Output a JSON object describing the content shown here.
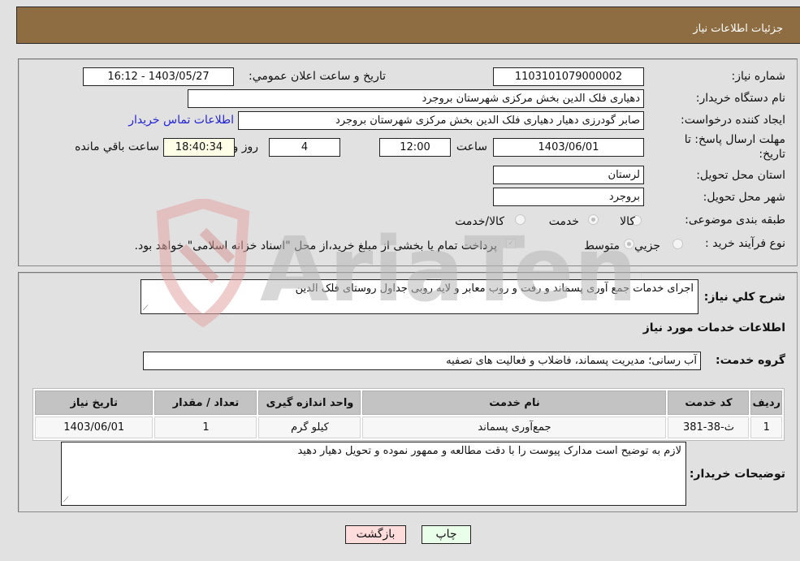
{
  "header": {
    "title": "جزئيات اطلاعات نياز"
  },
  "details": {
    "need_number_label": "شماره نیاز:",
    "need_number": "1103101079000002",
    "announce_label": "تاريخ و ساعت اعلان عمومي:",
    "announce_value": "1403/05/27 - 16:12",
    "buyer_org_label": "نام دستگاه خریدار:",
    "buyer_org": "دهیاری فلک الدین بخش مرکزی شهرستان بروجرد",
    "creator_label": "ایجاد کننده درخواست:",
    "creator": "صابر گودرزی دهیار دهیاری فلک الدین بخش مرکزی شهرستان بروجرد",
    "contact_link": "اطلاعات تماس خریدار",
    "deadline_label_line1": "مهلت ارسال پاسخ: تا",
    "deadline_label_line2": "تاریخ:",
    "deadline_date": "1403/06/01",
    "time_label": "ساعت",
    "deadline_time": "12:00",
    "days_value": "4",
    "days_label": "روز و",
    "remaining_time": "18:40:34",
    "remaining_label": "ساعت باقي مانده",
    "province_label": "استان محل تحویل:",
    "province": "لرستان",
    "city_label": "شهر محل تحویل:",
    "city": "بروجرد",
    "category_label": "طبقه بندی موضوعی:",
    "category_options": [
      {
        "label": "کالا",
        "checked": false
      },
      {
        "label": "خدمت",
        "checked": true
      },
      {
        "label": "کالا/خدمت",
        "checked": false
      }
    ],
    "process_label": "نوع فرآیند خرید :",
    "process_options": [
      {
        "label": "جزيي",
        "checked": false
      },
      {
        "label": "متوسط",
        "checked": true
      }
    ],
    "payment_note": "پرداخت تمام یا بخشی از مبلغ خرید،از محل \"اسناد خزانه اسلامی\" خواهد بود.",
    "payment_checked": true
  },
  "description": {
    "label": "شرح كلي نياز:",
    "value": "اجرای خدمات جمع آوری پسماند و رفت و روب معابر و لایه روبی جداول روستای فلک الدین"
  },
  "services": {
    "section_title": "اطلاعات خدمات مورد نياز",
    "group_label": "گروه خدمت:",
    "group_value": "آب رسانی؛ مدیریت پسماند، فاضلاب و فعالیت های تصفیه",
    "table": {
      "headers": [
        "ردیف",
        "کد خدمت",
        "نام خدمت",
        "واحد اندازه گیری",
        "تعداد / مقدار",
        "تاریخ نیاز"
      ],
      "rows": [
        [
          "1",
          "ث-38-381",
          "جمع‌آوری پسماند",
          "کیلو گرم",
          "1",
          "1403/06/01"
        ]
      ]
    }
  },
  "buyer_notes": {
    "label": "توضیحات خریدار:",
    "value": "لازم به توضیح است مدارک پیوست را با دقت مطالعه و ممهور نموده و تحویل دهیار دهید"
  },
  "buttons": {
    "print": "چاپ",
    "back": "بازگشت"
  },
  "colors": {
    "header": "#8f6d42",
    "print_bg": "#eaffea",
    "back_bg": "#ffdcdc",
    "link": "#2323d8"
  },
  "watermark": {
    "text": "AriaTender.neT"
  }
}
